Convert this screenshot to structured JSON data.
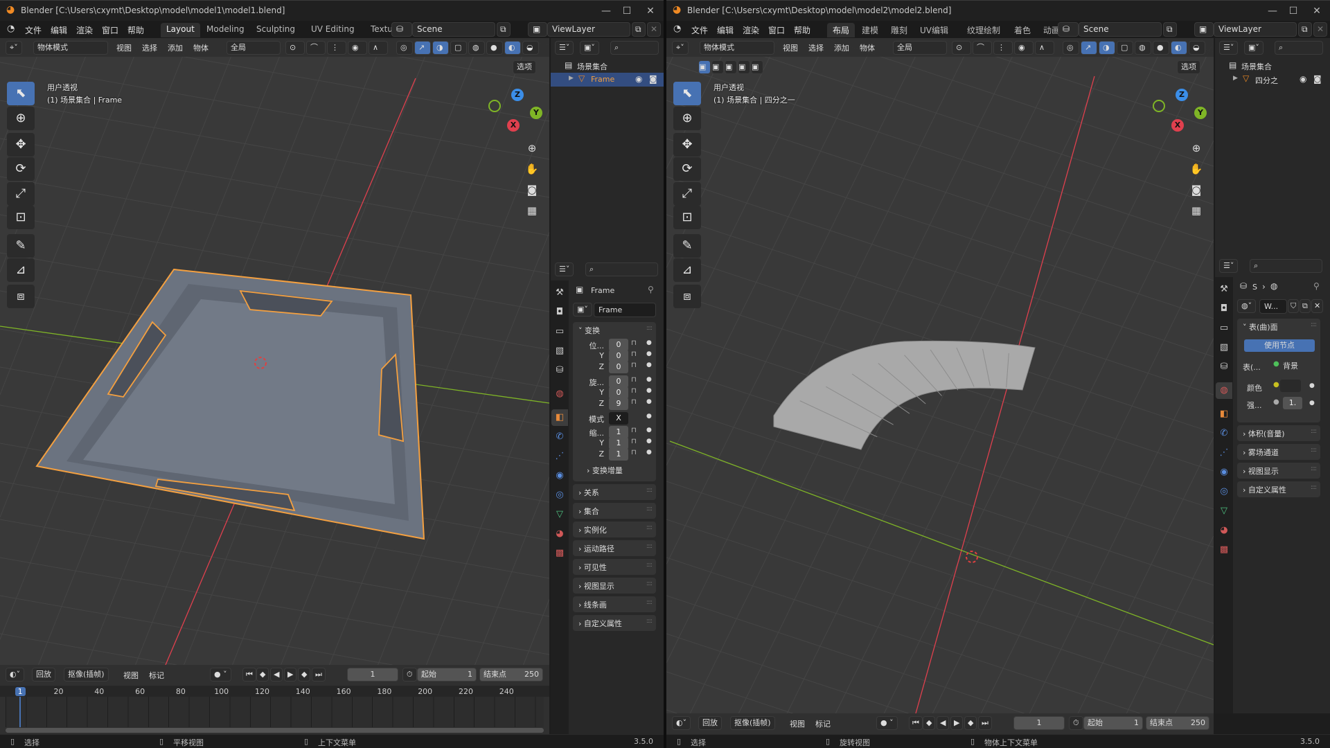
{
  "windows": [
    {
      "title": "Blender [C:\\Users\\cxymt\\Desktop\\model\\model1\\model1.blend]",
      "menu": [
        "文件",
        "编辑",
        "渲染",
        "窗口",
        "帮助"
      ],
      "workspaces": [
        "Layout",
        "Modeling",
        "Sculpting",
        "UV Editing",
        "Texture Pai"
      ],
      "active_workspace": 0,
      "scene": "Scene",
      "view_layer": "ViewLayer",
      "viewport": {
        "mode": "物体模式",
        "menus": [
          "视图",
          "选择",
          "添加",
          "物体"
        ],
        "orientation": "全局",
        "options": "选项",
        "view_name": "用户透视",
        "context": "(1) 场景集合 | Frame",
        "gizmo": {
          "x": "X",
          "y": "Y",
          "z": "Z"
        }
      },
      "outliner": {
        "collection": "场景集合",
        "object": "Frame",
        "selected": true
      },
      "properties": {
        "kind": "object",
        "object_name": "Frame",
        "datablock": "Frame",
        "panel": "变换",
        "rows": [
          {
            "label": "位...",
            "value": "0"
          },
          {
            "label": "Y",
            "value": "0"
          },
          {
            "label": "Z",
            "value": "0"
          },
          {
            "label": "旋...",
            "value": "0"
          },
          {
            "label": "Y",
            "value": "0"
          },
          {
            "label": "Z",
            "value": "9"
          },
          {
            "label": "模式",
            "value": "X"
          },
          {
            "label": "缩...",
            "value": "1"
          },
          {
            "label": "Y",
            "value": "1"
          },
          {
            "label": "Z",
            "value": "1"
          }
        ],
        "subpanel": "变换增量",
        "collapsed": [
          "关系",
          "集合",
          "实例化",
          "运动路径",
          "可见性",
          "视图显示",
          "线条画",
          "自定义属性"
        ]
      },
      "timeline": {
        "playback": "回放",
        "keying": "抠像(插帧)",
        "menus": [
          "视图",
          "标记"
        ],
        "current_frame": "1",
        "start_label": "起始",
        "start": "1",
        "end_label": "结束点",
        "end": "250",
        "ruler": [
          "1",
          "20",
          "40",
          "60",
          "80",
          "100",
          "120",
          "140",
          "160",
          "180",
          "200",
          "220",
          "240"
        ]
      },
      "status": [
        "选择",
        "平移视图",
        "上下文菜单"
      ],
      "version": "3.5.0"
    },
    {
      "title": "Blender [C:\\Users\\cxymt\\Desktop\\model\\model2\\model2.blend]",
      "menu": [
        "文件",
        "编辑",
        "渲染",
        "窗口",
        "帮助"
      ],
      "workspaces": [
        "布局",
        "建模",
        "雕刻",
        "UV编辑",
        "纹理绘制",
        "着色",
        "动画"
      ],
      "active_workspace": 0,
      "scene": "Scene",
      "view_layer": "ViewLayer",
      "viewport": {
        "mode": "物体模式",
        "menus": [
          "视图",
          "选择",
          "添加",
          "物体"
        ],
        "orientation": "全局",
        "options": "选项",
        "view_name": "用户透视",
        "context": "(1) 场景集合 | 四分之一",
        "gizmo": {
          "x": "X",
          "y": "Y",
          "z": "Z"
        }
      },
      "outliner": {
        "collection": "场景集合",
        "object": "四分之",
        "selected": false
      },
      "properties": {
        "kind": "world",
        "breadcrumb": "S",
        "datablock": "W...",
        "panel": "表(曲)面",
        "use_nodes": "使用节点",
        "surface_label": "表(...",
        "surface_value": "背景",
        "color_label": "颜色",
        "strength_label": "强...",
        "strength_value": "1.",
        "collapsed": [
          "体积(音量)",
          "雾场通道",
          "视图显示",
          "自定义属性"
        ]
      },
      "timeline": {
        "playback": "回放",
        "keying": "抠像(插帧)",
        "menus": [
          "视图",
          "标记"
        ],
        "current_frame": "1",
        "start_label": "起始",
        "start": "1",
        "end_label": "结束点",
        "end": "250"
      },
      "status": [
        "选择",
        "旋转视图",
        "物体上下文菜单"
      ],
      "version": "3.5.0"
    }
  ],
  "colors": {
    "accent": "#4772b3",
    "selection": "#f4a040",
    "x_axis": "#e0404e",
    "y_axis": "#7fb526",
    "z_axis": "#3b8ee8"
  }
}
